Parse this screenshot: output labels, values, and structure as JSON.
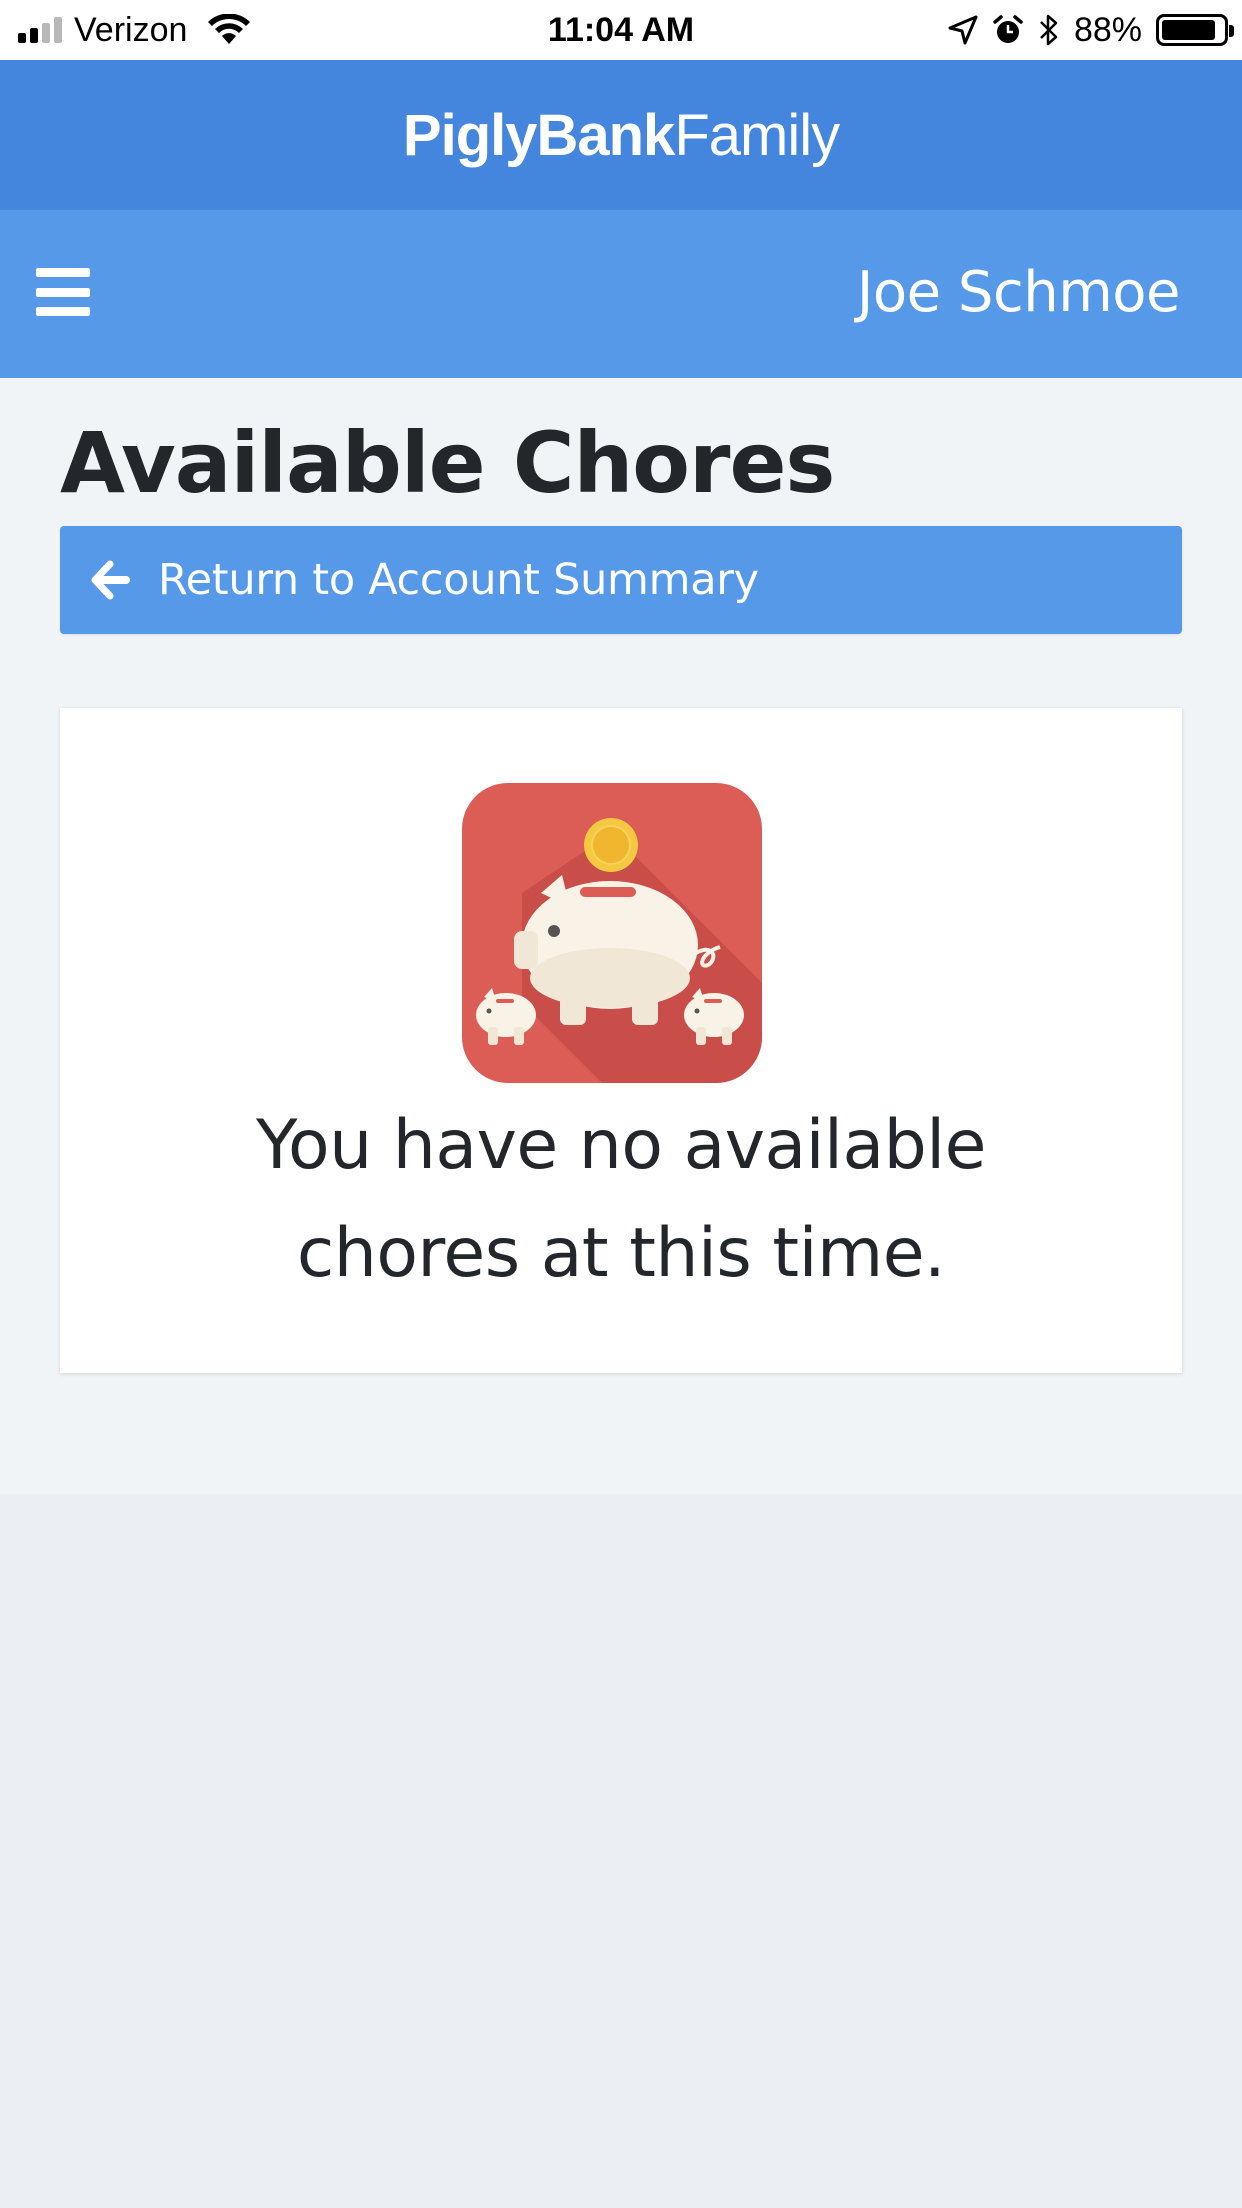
{
  "status_bar": {
    "carrier": "Verizon",
    "time": "11:04 AM",
    "battery_percent": "88%",
    "battery_level": 0.88,
    "signal_icon": "signal-bars-icon",
    "wifi_icon": "wifi-icon",
    "location_icon": "location-arrow-icon",
    "alarm_icon": "alarm-clock-icon",
    "bluetooth_icon": "bluetooth-icon"
  },
  "brand": {
    "name_bold": "PiglyBank",
    "name_light": "Family"
  },
  "user_bar": {
    "menu_icon": "hamburger-menu-icon",
    "user_name": "Joe Schmoe"
  },
  "page": {
    "title": "Available Chores",
    "return_button_label": "Return to Account Summary",
    "return_icon": "arrow-left-icon",
    "logo_icon": "piggy-bank-family-icon",
    "empty_message_line1": "You have no available",
    "empty_message_line2": "chores at this time."
  },
  "colors": {
    "brand_bar": "#4486dd",
    "user_bar": "#5599e8",
    "button": "#5599e8",
    "content_bg": "#f0f4f7",
    "lower_bg": "#ebeef2",
    "logo_red": "#dc5c56",
    "coin": "#f5c842"
  }
}
